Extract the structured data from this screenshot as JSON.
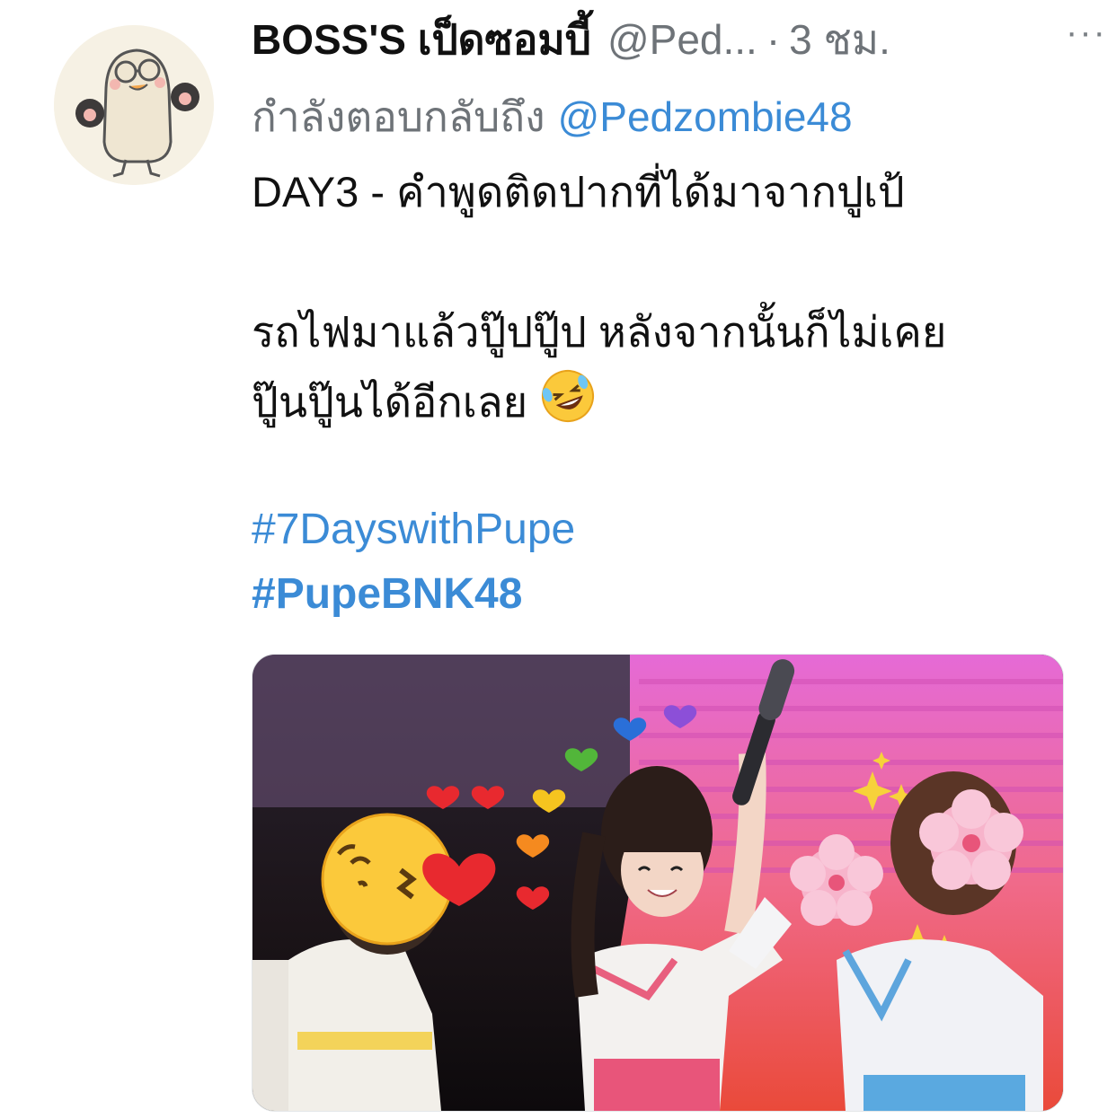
{
  "tweet": {
    "display_name": "BOSS'S เป็ดซอมบี้",
    "handle": "@Ped...",
    "separator": "·",
    "time": "3 ชม.",
    "more_label": "···",
    "replying_prefix": "กำลังตอบกลับถึง",
    "replying_mention": "@Pedzombie48",
    "line1": "DAY3 - คำพูดติดปากที่ได้มาจากปูเป้",
    "line2": "รถไฟมาแล้วปู๊ปปู๊ป หลังจากนั้นก็ไม่เคย",
    "line3": "ปู๊นปู๊นได้อีกเลย",
    "hashtag1": "#7DayswithPupe",
    "hashtag2": "#PupeBNK48"
  },
  "icons": {
    "line3_emoji": "rolling-on-the-floor-laughing-emoji",
    "avatar": "cartoon-egg-mascot-with-glasses-avatar",
    "more": "more-options-icon"
  },
  "colors": {
    "link": "#3b8bd6",
    "muted": "#6e7378",
    "text": "#111111"
  }
}
